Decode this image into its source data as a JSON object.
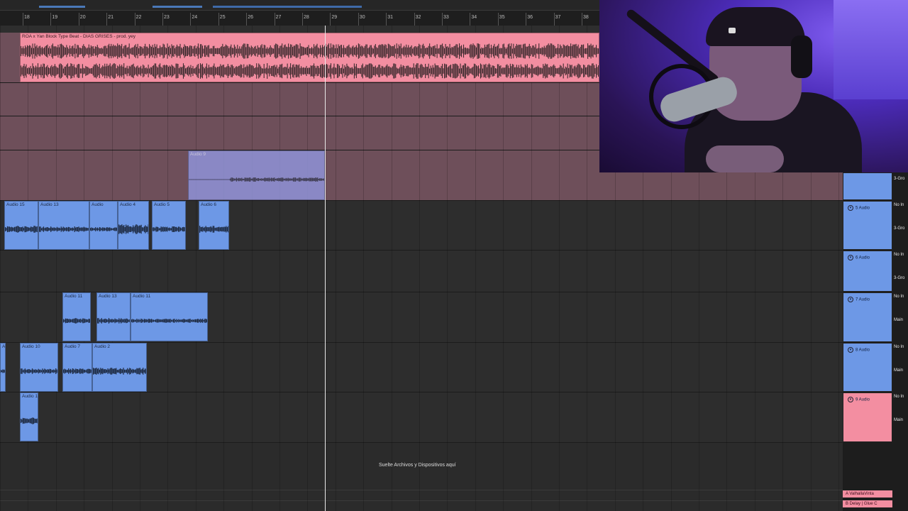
{
  "ruler": {
    "bars": [
      "18",
      "19",
      "20",
      "21",
      "22",
      "23",
      "24",
      "25",
      "26",
      "27",
      "28",
      "29",
      "30",
      "31",
      "32",
      "33",
      "34",
      "35",
      "36",
      "37",
      "38"
    ]
  },
  "tracks": {
    "main_clip": {
      "title": "ROA x Yan Block Type Beat - DIAS GRISES - prod. yey"
    },
    "audio9_clip": {
      "title": "Audio 9"
    },
    "row1_clips": [
      "Audio 15",
      "Audio 13",
      "Audio",
      "Audio 4",
      "Audio 5",
      "Audio 6"
    ],
    "row3_clips": [
      "Audio 11",
      "Audio 13",
      "Audio 11"
    ],
    "row4_clips": [
      "A",
      "Audio 10",
      "Audio 7",
      "Audio 2"
    ],
    "row5_clips": [
      "Audio 1"
    ]
  },
  "drop_area": {
    "text": "Suelte Archivos y Dispositivos aquí"
  },
  "mixer": {
    "top_io": "3-Gro",
    "tracks": [
      {
        "name": "5 Audio",
        "input": "No In",
        "output": "3-Gro",
        "color": "#6d98e6"
      },
      {
        "name": "6 Audio",
        "input": "No In",
        "output": "3-Gro",
        "color": "#6d98e6"
      },
      {
        "name": "7 Audio",
        "input": "No In",
        "output": "Main",
        "color": "#6d98e6"
      },
      {
        "name": "8 Audio",
        "input": "No In",
        "output": "Main",
        "color": "#6d98e6"
      },
      {
        "name": "9 Audio",
        "input": "No In",
        "output": "Main",
        "color": "#f38ea1"
      }
    ],
    "returns": [
      "A ValhallaVinta",
      "B Delay | Glue C"
    ]
  },
  "colors": {
    "pink_clip": "#f38ea1",
    "blue_clip": "#6d98e6",
    "playhead": "#e9e9e9",
    "pink_lane": "#6e4f5a"
  }
}
